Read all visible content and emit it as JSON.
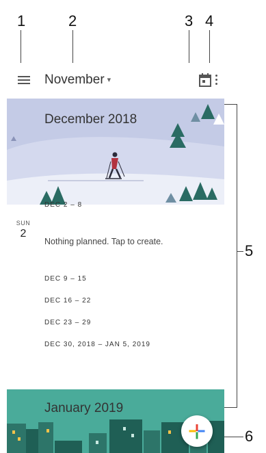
{
  "callouts": [
    "1",
    "2",
    "3",
    "4",
    "5",
    "6"
  ],
  "appbar": {
    "menu_icon": "menu-icon",
    "month_label": "November",
    "caret": "▾",
    "today_icon": "calendar-today-icon",
    "more_icon": "more-vert-icon"
  },
  "schedule": {
    "december_title": "December 2018",
    "weeks_top": {
      "label": "DEC 2 – 8"
    },
    "day": {
      "name": "SUN",
      "number": "2",
      "text": "Nothing planned. Tap to create."
    },
    "weeks": [
      "DEC 9 – 15",
      "DEC 16 – 22",
      "DEC 23 – 29",
      "DEC 30, 2018 – JAN 5, 2019"
    ],
    "january_title": "January 2019"
  },
  "fab": {
    "icon": "plus-icon"
  },
  "colors": {
    "december_sky": "#c4cbe6",
    "december_snow": "#eceff8",
    "tree": "#2a6b63",
    "january_bg": "#4aab9a",
    "january_buildings": "#2d7569",
    "fab_plus": [
      "#4285f4",
      "#ea4335",
      "#fbbc05",
      "#34a853"
    ]
  }
}
